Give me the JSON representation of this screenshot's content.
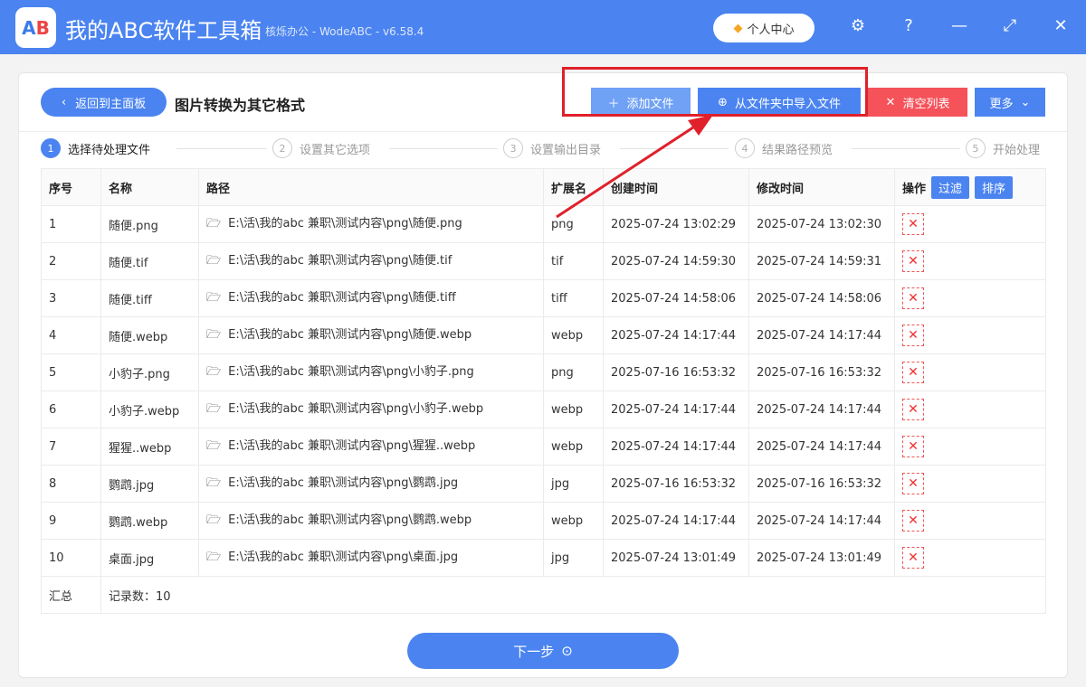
{
  "app": {
    "title": "我的ABC软件工具箱",
    "subtitle": "核烁办公 - WodeABC - v6.58.4",
    "user_center": "个人中心",
    "logo_text": "AB"
  },
  "toolbar": {
    "back": "返回到主面板",
    "page_title": "图片转换为其它格式",
    "add_file": "添加文件",
    "import_folder": "从文件夹中导入文件",
    "clear_list": "清空列表",
    "more": "更多"
  },
  "steps": [
    {
      "n": "1",
      "label": "选择待处理文件"
    },
    {
      "n": "2",
      "label": "设置其它选项"
    },
    {
      "n": "3",
      "label": "设置输出目录"
    },
    {
      "n": "4",
      "label": "结果路径预览"
    },
    {
      "n": "5",
      "label": "开始处理"
    }
  ],
  "table": {
    "headers": {
      "index": "序号",
      "name": "名称",
      "path": "路径",
      "ext": "扩展名",
      "created": "创建时间",
      "modified": "修改时间",
      "action": "操作",
      "filter": "过滤",
      "sort": "排序"
    },
    "rows": [
      [
        "1",
        "随便.png",
        "E:\\活\\我的abc 兼职\\测试内容\\png\\随便.png",
        "png",
        "2025-07-24 13:02:29",
        "2025-07-24 13:02:30"
      ],
      [
        "2",
        "随便.tif",
        "E:\\活\\我的abc 兼职\\测试内容\\png\\随便.tif",
        "tif",
        "2025-07-24 14:59:30",
        "2025-07-24 14:59:31"
      ],
      [
        "3",
        "随便.tiff",
        "E:\\活\\我的abc 兼职\\测试内容\\png\\随便.tiff",
        "tiff",
        "2025-07-24 14:58:06",
        "2025-07-24 14:58:06"
      ],
      [
        "4",
        "随便.webp",
        "E:\\活\\我的abc 兼职\\测试内容\\png\\随便.webp",
        "webp",
        "2025-07-24 14:17:44",
        "2025-07-24 14:17:44"
      ],
      [
        "5",
        "小豹子.png",
        "E:\\活\\我的abc 兼职\\测试内容\\png\\小豹子.png",
        "png",
        "2025-07-16 16:53:32",
        "2025-07-16 16:53:32"
      ],
      [
        "6",
        "小豹子.webp",
        "E:\\活\\我的abc 兼职\\测试内容\\png\\小豹子.webp",
        "webp",
        "2025-07-24 14:17:44",
        "2025-07-24 14:17:44"
      ],
      [
        "7",
        "猩猩..webp",
        "E:\\活\\我的abc 兼职\\测试内容\\png\\猩猩..webp",
        "webp",
        "2025-07-24 14:17:44",
        "2025-07-24 14:17:44"
      ],
      [
        "8",
        "鹦鹉.jpg",
        "E:\\活\\我的abc 兼职\\测试内容\\png\\鹦鹉.jpg",
        "jpg",
        "2025-07-16 16:53:32",
        "2025-07-16 16:53:32"
      ],
      [
        "9",
        "鹦鹉.webp",
        "E:\\活\\我的abc 兼职\\测试内容\\png\\鹦鹉.webp",
        "webp",
        "2025-07-24 14:17:44",
        "2025-07-24 14:17:44"
      ],
      [
        "10",
        "桌面.jpg",
        "E:\\活\\我的abc 兼职\\测试内容\\png\\桌面.jpg",
        "jpg",
        "2025-07-24 13:01:49",
        "2025-07-24 13:01:49"
      ]
    ],
    "summary_label": "汇总",
    "summary_value": "记录数：10"
  },
  "next_button": "下一步",
  "colors": {
    "primary": "#4b84f0",
    "danger": "#f5525a",
    "highlight": "#e0202a"
  }
}
